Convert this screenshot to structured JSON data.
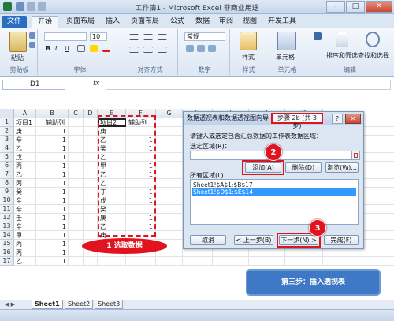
{
  "window": {
    "title": "工作簿1 - Microsoft Excel 非商业用途",
    "min": "–",
    "max": "□",
    "close": "✕"
  },
  "tabs": [
    "文件",
    "开始",
    "页面布局",
    "插入",
    "页面布局",
    "公式",
    "数据",
    "审阅",
    "视图",
    "开发工具"
  ],
  "ribbon": {
    "font_size": "10",
    "number_format": "常规",
    "font_bold": "B",
    "font_italic": "I",
    "font_underline": "U",
    "groups": [
      "剪贴板",
      "字体",
      "对齐方式",
      "数字",
      "样式",
      "单元格",
      "编辑"
    ],
    "buttons": {
      "paste": "粘贴",
      "style": "样式",
      "cells": "单元格",
      "sort": "排序和筛选",
      "find": "查找和选择"
    }
  },
  "formula": {
    "namebox": "D1",
    "fx": "fx",
    "content": ""
  },
  "columns": [
    "A",
    "B",
    "C",
    "D",
    "E",
    "F",
    "G",
    "H",
    "I",
    "J",
    "K"
  ],
  "rows": [
    "1",
    "2",
    "3",
    "4",
    "5",
    "6",
    "7",
    "8",
    "9",
    "10",
    "11",
    "12",
    "13",
    "14",
    "15",
    "16",
    "17"
  ],
  "sheet_ab": [
    [
      "项目1",
      "辅助列"
    ],
    [
      "庚",
      "1"
    ],
    [
      "辛",
      "1"
    ],
    [
      "乙",
      "1"
    ],
    [
      "戊",
      "1"
    ],
    [
      "丙",
      "1"
    ],
    [
      "乙",
      "1"
    ],
    [
      "丙",
      "1"
    ],
    [
      "癸",
      "1"
    ],
    [
      "辛",
      "1"
    ],
    [
      "辛",
      "1"
    ],
    [
      "壬",
      "1"
    ],
    [
      "辛",
      "1"
    ],
    [
      "甲",
      "1"
    ],
    [
      "丙",
      "1"
    ],
    [
      "丙",
      "1"
    ],
    [
      "乙",
      "1"
    ]
  ],
  "sheet_de": [
    [
      "项目2",
      "辅助列"
    ],
    [
      "庚",
      "1"
    ],
    [
      "乙",
      "1"
    ],
    [
      "癸",
      "1"
    ],
    [
      "乙",
      "1"
    ],
    [
      "甲",
      "1"
    ],
    [
      "乙",
      "1"
    ],
    [
      "乙",
      "1"
    ],
    [
      "丁",
      "1"
    ],
    [
      "戊",
      "1"
    ],
    [
      "癸",
      "1"
    ],
    [
      "庚",
      "1"
    ],
    [
      "乙",
      "1"
    ],
    [
      "庚",
      "1"
    ]
  ],
  "annotations": {
    "step1": "1 选取数据",
    "step2": "2",
    "step3": "3",
    "step3_banner": "第三步：插入透视表"
  },
  "dialog": {
    "title": "数据透视表和数据透视图向导 -",
    "step": "步骤 2b (共 3 步)",
    "help": "?",
    "close": "✕",
    "prompt": "请键入或选定包含汇总数据的工作表数据区域：",
    "range_label": "选定区域(R)：",
    "range_value": "",
    "add_button": "添加(A)",
    "delete_button": "删除(D)",
    "browse_button": "浏览(W)...",
    "all_ranges_label": "所有区域(L)：",
    "ranges": [
      "Sheet1!$A$1:$B$17",
      "Sheet1!$D$1:$E$14"
    ],
    "cancel_button": "取消",
    "back_button": "< 上一步(B)",
    "next_button": "下一步(N) >",
    "finish_button": "完成(F)"
  },
  "sheets": [
    "Sheet1",
    "Sheet2",
    "Sheet3"
  ],
  "colors": {
    "accent": "#2a6fbf",
    "annotation_red": "#e0141e",
    "banner_blue": "#3f79c6"
  }
}
